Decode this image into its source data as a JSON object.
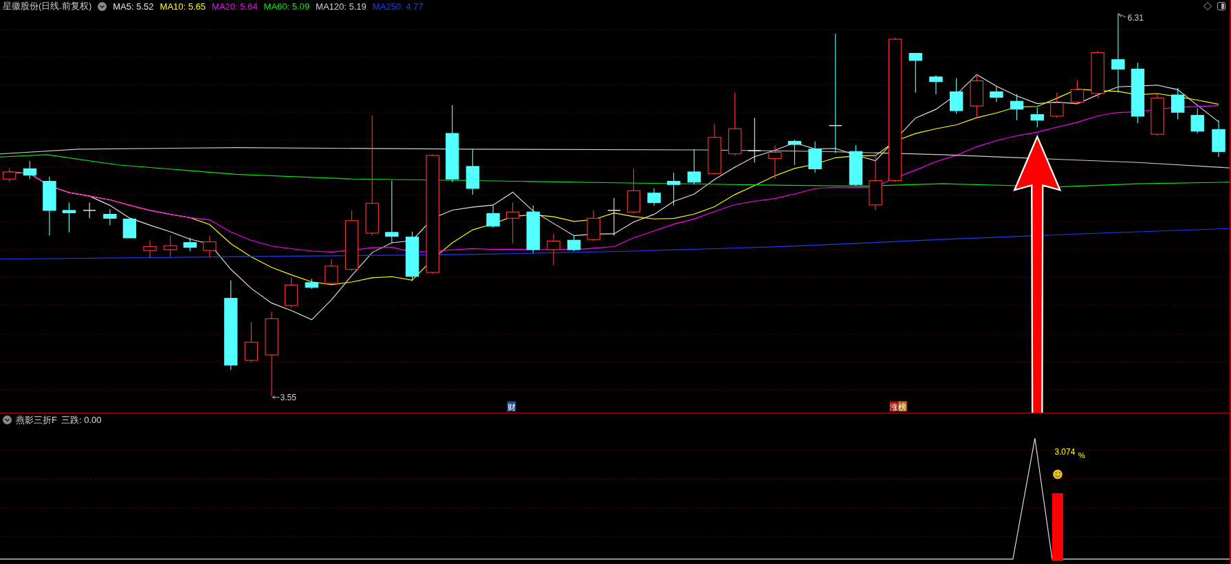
{
  "main_chart": {
    "title": "星徽股份(日线.前复权)",
    "moving_averages": [
      {
        "label": "MA5: 5.52",
        "color": "#e6e6e6"
      },
      {
        "label": "MA10: 5.65",
        "color": "#ffff00"
      },
      {
        "label": "MA20: 5.64",
        "color": "#ff00ff"
      },
      {
        "label": "MA60: 5.09",
        "color": "#00ee00"
      },
      {
        "label": "MA120: 5.19",
        "color": "#d0d0d0"
      },
      {
        "label": "MA250: 4.77",
        "color": "#1a3cff"
      }
    ],
    "low_label": "3.55",
    "high_label": "6.31",
    "event_tags": [
      {
        "text": "财",
        "kind": "finance"
      },
      {
        "text": "涨榜",
        "kind": "top-gainers"
      }
    ]
  },
  "indicator": {
    "name": "燕影三折F",
    "reading": "三跌: 0.00",
    "value": "3.074",
    "unit": "%"
  }
}
